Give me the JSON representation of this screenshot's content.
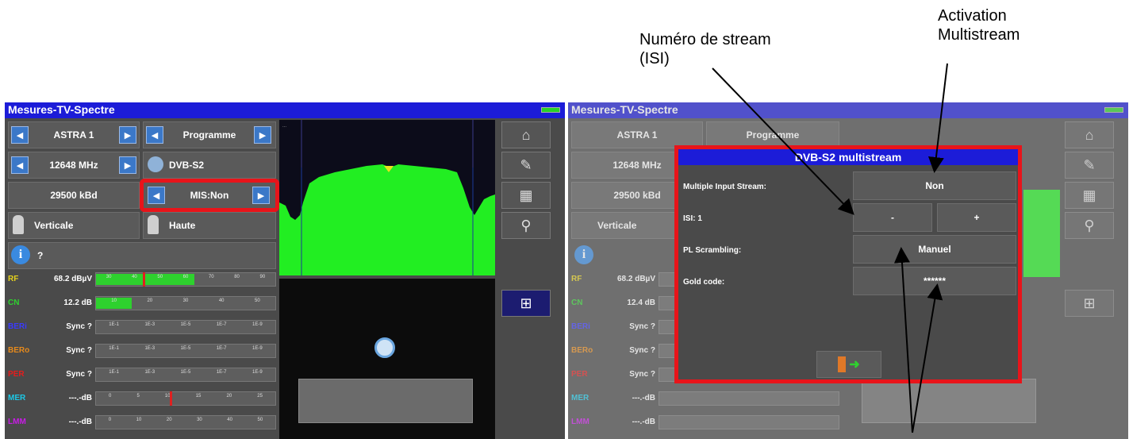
{
  "annotations": {
    "stream_line1": "Numéro de stream",
    "stream_line2": "(ISI)",
    "activation_line1": "Activation",
    "activation_line2": "Multistream"
  },
  "left": {
    "title": "Mesures-TV-Spectre",
    "satellite": "ASTRA 1",
    "programme": "Programme",
    "frequency": "12648 MHz",
    "standard": "DVB-S2",
    "symbol_rate": "29500 kBd",
    "mis_button": "MIS:Non",
    "polarisation": "Verticale",
    "band": "Haute",
    "info": "?",
    "measures": [
      {
        "label": "RF",
        "value": "68.2 dBµV",
        "color": "#e6d21c",
        "fill": 0.55,
        "ticks": [
          "30",
          "40",
          "50",
          "60",
          "70",
          "80",
          "90"
        ]
      },
      {
        "label": "CN",
        "value": "12.2 dB",
        "color": "#2fd12f",
        "fill": 0.2,
        "ticks": [
          "10",
          "20",
          "30",
          "40",
          "50"
        ]
      },
      {
        "label": "BERi",
        "value": "Sync ?",
        "color": "#3a3aff",
        "ticks": [
          "1E-1",
          "1E-3",
          "1E-5",
          "1E-7",
          "1E-9"
        ]
      },
      {
        "label": "BERo",
        "value": "Sync ?",
        "color": "#e68a1c",
        "ticks": [
          "1E-1",
          "1E-3",
          "1E-5",
          "1E-7",
          "1E-9"
        ]
      },
      {
        "label": "PER",
        "value": "Sync ?",
        "color": "#e61c1c",
        "ticks": [
          "1E-1",
          "1E-3",
          "1E-5",
          "1E-7",
          "1E-9"
        ]
      },
      {
        "label": "MER",
        "value": "---.-dB",
        "color": "#1cc8e6",
        "ticks": [
          "0",
          "5",
          "10",
          "15",
          "20",
          "25"
        ]
      },
      {
        "label": "LMM",
        "value": "---.-dB",
        "color": "#c81ce6",
        "ticks": [
          "0",
          "10",
          "20",
          "30",
          "40",
          "50"
        ]
      }
    ]
  },
  "right": {
    "title": "Mesures-TV-Spectre",
    "satellite": "ASTRA 1",
    "programme": "Programme",
    "frequency": "12648 MHz",
    "symbol_rate": "29500 kBd",
    "polarisation": "Verticale",
    "measures": [
      {
        "label": "RF",
        "value": "68.2 dBµV"
      },
      {
        "label": "CN",
        "value": "12.4 dB"
      },
      {
        "label": "BERi",
        "value": "Sync ?"
      },
      {
        "label": "BERo",
        "value": "Sync ?"
      },
      {
        "label": "PER",
        "value": "Sync ?"
      },
      {
        "label": "MER",
        "value": "---.-dB"
      },
      {
        "label": "LMM",
        "value": "---.-dB"
      }
    ],
    "dialog": {
      "title": "DVB-S2 multistream",
      "mis_label": "Multiple Input Stream:",
      "mis_value": "Non",
      "isi_label": "ISI: 1",
      "isi_minus": "-",
      "isi_plus": "+",
      "pl_label": "PL Scrambling:",
      "pl_value": "Manuel",
      "gold_label": "Gold code:",
      "gold_value": "******"
    }
  }
}
